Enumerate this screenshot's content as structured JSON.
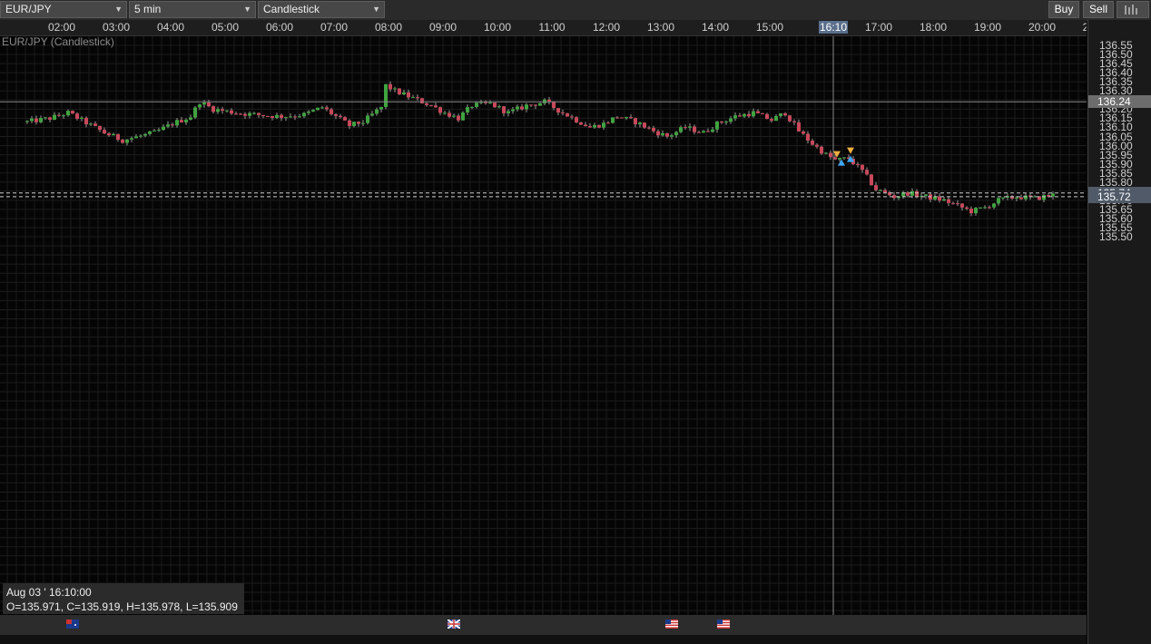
{
  "toolbar": {
    "symbol": "EUR/JPY",
    "interval": "5 min",
    "chart_type": "Candlestick",
    "buy_label": "Buy",
    "sell_label": "Sell"
  },
  "chart_title": "EUR/JPY (Candlestick)",
  "time_axis": {
    "labels": [
      "02:00",
      "03:00",
      "04:00",
      "05:00",
      "06:00",
      "07:00",
      "08:00",
      "09:00",
      "10:00",
      "11:00",
      "12:00",
      "13:00",
      "14:00",
      "15:00",
      "16:10",
      "17:00",
      "18:00",
      "19:00",
      "20:00",
      "2"
    ],
    "highlighted": "16:10"
  },
  "price_axis": {
    "labels": [
      "136.55",
      "136.50",
      "136.45",
      "136.40",
      "136.35",
      "136.30",
      "136.20",
      "136.15",
      "136.10",
      "136.05",
      "136.00",
      "135.95",
      "135.90",
      "135.85",
      "135.80",
      "135.70",
      "135.65",
      "135.60",
      "135.55",
      "135.50"
    ],
    "crosshair_price": "136.24",
    "line1_price": "135.74",
    "line2_price": "135.72"
  },
  "ohlc_box": {
    "date": "Aug 03 ' 16:10:00",
    "line": "O=135.971, C=135.919, H=135.978, L=135.909"
  },
  "flags": [
    "australia-flag-icon",
    "uk-flag-icon",
    "us-flag-icon",
    "us-flag-icon"
  ],
  "chart_data": {
    "type": "candlestick",
    "symbol": "EUR/JPY",
    "interval": "5 min",
    "x_time_labels": [
      "02:00",
      "03:00",
      "04:00",
      "05:00",
      "06:00",
      "07:00",
      "08:00",
      "09:00",
      "10:00",
      "11:00",
      "12:00",
      "13:00",
      "14:00",
      "15:00",
      "16:10",
      "17:00",
      "18:00",
      "19:00",
      "20:00"
    ],
    "ylim": [
      135.48,
      136.58
    ],
    "anchors_time_close": [
      [
        "01:20",
        136.13
      ],
      [
        "01:45",
        136.15
      ],
      [
        "02:05",
        136.18
      ],
      [
        "02:45",
        136.07
      ],
      [
        "03:05",
        136.03
      ],
      [
        "03:40",
        136.07
      ],
      [
        "04:00",
        136.12
      ],
      [
        "04:20",
        136.16
      ],
      [
        "04:30",
        136.24
      ],
      [
        "04:45",
        136.2
      ],
      [
        "05:10",
        136.18
      ],
      [
        "05:30",
        136.17
      ],
      [
        "06:00",
        136.16
      ],
      [
        "06:25",
        136.17
      ],
      [
        "06:45",
        136.21
      ],
      [
        "07:00",
        136.16
      ],
      [
        "07:15",
        136.11
      ],
      [
        "07:30",
        136.13
      ],
      [
        "07:50",
        136.21
      ],
      [
        "07:55",
        136.33
      ],
      [
        "08:05",
        136.3
      ],
      [
        "08:25",
        136.26
      ],
      [
        "08:45",
        136.22
      ],
      [
        "09:00",
        136.18
      ],
      [
        "09:15",
        136.15
      ],
      [
        "09:30",
        136.22
      ],
      [
        "09:50",
        136.23
      ],
      [
        "10:10",
        136.18
      ],
      [
        "10:30",
        136.22
      ],
      [
        "10:50",
        136.24
      ],
      [
        "11:10",
        136.18
      ],
      [
        "11:25",
        136.14
      ],
      [
        "11:40",
        136.1
      ],
      [
        "11:55",
        136.12
      ],
      [
        "12:10",
        136.16
      ],
      [
        "12:30",
        136.13
      ],
      [
        "12:50",
        136.08
      ],
      [
        "13:05",
        136.05
      ],
      [
        "13:25",
        136.1
      ],
      [
        "13:45",
        136.07
      ],
      [
        "14:00",
        136.12
      ],
      [
        "14:20",
        136.16
      ],
      [
        "14:40",
        136.18
      ],
      [
        "15:00",
        136.14
      ],
      [
        "15:15",
        136.18
      ],
      [
        "15:30",
        136.08
      ],
      [
        "15:45",
        136.01
      ],
      [
        "16:00",
        135.95
      ],
      [
        "16:10",
        135.92
      ],
      [
        "16:25",
        135.93
      ],
      [
        "16:40",
        135.86
      ],
      [
        "16:55",
        135.76
      ],
      [
        "17:15",
        135.72
      ],
      [
        "17:30",
        135.74
      ],
      [
        "17:50",
        135.72
      ],
      [
        "18:10",
        135.7
      ],
      [
        "18:25",
        135.67
      ],
      [
        "18:40",
        135.64
      ],
      [
        "18:55",
        135.66
      ],
      [
        "19:10",
        135.7
      ],
      [
        "19:30",
        135.72
      ],
      [
        "19:50",
        135.71
      ],
      [
        "20:10",
        135.73
      ]
    ],
    "crosshair": {
      "time": "16:10",
      "price": 136.24
    },
    "horizontal_lines": [
      135.74,
      135.72
    ],
    "trade_markers": [
      {
        "time": "16:10",
        "price": 135.95,
        "dir": "down",
        "color": "#f0b040"
      },
      {
        "time": "16:15",
        "price": 135.91,
        "dir": "up",
        "color": "#3fa9f5"
      },
      {
        "time": "16:25",
        "price": 135.97,
        "dir": "down",
        "color": "#f0b040"
      },
      {
        "time": "16:25",
        "price": 135.93,
        "dir": "up",
        "color": "#3fa9f5"
      }
    ],
    "colors": {
      "up": "#3fa33f",
      "down": "#c8485a",
      "grid": "#1c1c1c",
      "crosshair": "#888888"
    }
  }
}
